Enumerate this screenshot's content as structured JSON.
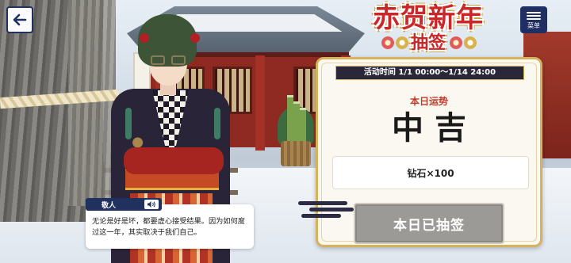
{
  "header": {
    "back_icon": "back-arrow-icon",
    "menu_icon": "hamburger-menu-icon",
    "menu_label": "菜单"
  },
  "logo": {
    "main": "赤贺新年",
    "sub": "抽签"
  },
  "panel": {
    "event_period": "活动时间 1/1 00:00～1/14 24:00",
    "fortune_label": "本日运势",
    "fortune_result": "中吉",
    "reward": "钻石×100",
    "button_label": "本日已抽签"
  },
  "dialogue": {
    "speaker": "敬人",
    "voice_icon": "speaker-volume-icon",
    "text": "无论是好是坏，都要虚心接受结果。因为如何度过这一年，其实取决于我们自己。"
  },
  "colors": {
    "navy": "#20305f",
    "accent_red": "#c9272a",
    "gold": "#d6b25b",
    "disabled_button": "#9c9a96"
  }
}
